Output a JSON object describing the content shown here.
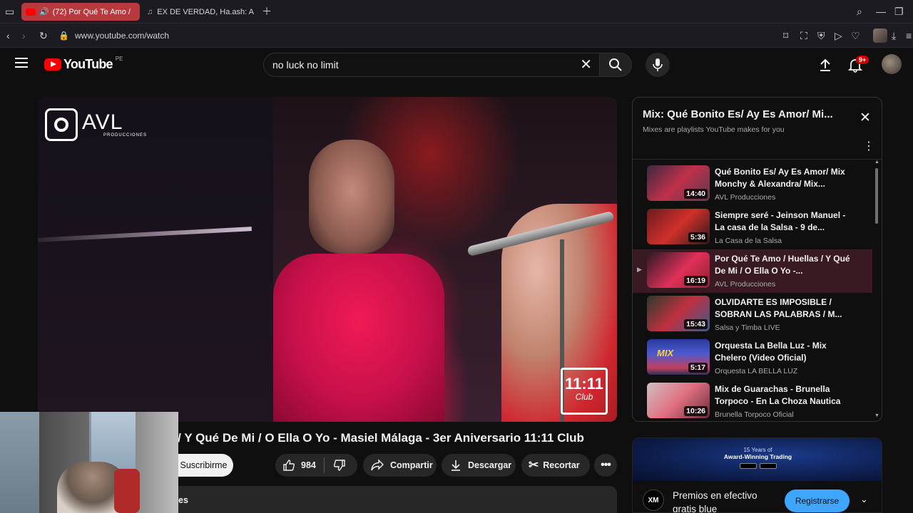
{
  "browser": {
    "tabs": [
      {
        "label": "(72) Por Qué Te Amo /",
        "active": true
      },
      {
        "label": "EX DE VERDAD, Ha.ash: A",
        "active": false
      }
    ],
    "url": "www.youtube.com/watch"
  },
  "header": {
    "logo_text": "YouTube",
    "country": "PE",
    "search_value": "no luck no limit",
    "notification_badge": "9+"
  },
  "player": {
    "watermark": "AVL",
    "watermark_sub": "PRODUCCIONES",
    "corner_logo_top": "11:11",
    "corner_logo_bottom": "Club"
  },
  "video": {
    "title": "s / Y Qué De Mi / O Ella O Yo - Masiel Málaga - 3er Aniversario 11:11 Club",
    "subscribe_label": "Suscribirme",
    "likes": "984",
    "share_label": "Compartir",
    "download_label": "Descargar",
    "clip_label": "Recortar",
    "desc_snippet": "es"
  },
  "mix": {
    "title": "Mix: Qué Bonito Es/ Ay Es Amor/ Mi...",
    "subtitle": "Mixes are playlists YouTube makes for you",
    "items": [
      {
        "title": "Qué Bonito Es/ Ay Es Amor/ Mix Monchy & Alexandra/ Mix...",
        "channel": "AVL Producciones",
        "duration": "14:40",
        "active": false
      },
      {
        "title": "Siempre seré - Jeinson Manuel - La casa de la Salsa - 9 de...",
        "channel": "La Casa de la Salsa",
        "duration": "5:36",
        "active": false
      },
      {
        "title": "Por Qué Te Amo / Huellas / Y Qué De Mi / O Ella O Yo -...",
        "channel": "AVL Producciones",
        "duration": "16:19",
        "active": true
      },
      {
        "title": "OLVIDARTE ES IMPOSIBLE / SOBRAN LAS PALABRAS / M...",
        "channel": "Salsa y Timba LIVE",
        "duration": "15:43",
        "active": false
      },
      {
        "title": "Orquesta La Bella Luz - Mix Chelero (Video Oficial)",
        "channel": "Orquesta LA BELLA LUZ",
        "duration": "5:17",
        "active": false
      },
      {
        "title": "Mix de Guarachas - Brunella Torpoco - En La Choza Nautica",
        "channel": "Brunella Torpoco Oficial",
        "duration": "10:26",
        "active": false
      }
    ]
  },
  "ad": {
    "banner_line1": "15 Years of",
    "banner_line2": "Award-Winning Trading",
    "brand": "XM",
    "text": "Premios en efectivo",
    "text2": "gratis blue",
    "cta": "Registrarse"
  },
  "colors": {
    "bg": "#0f0f0f",
    "accent_red": "#ff0000",
    "cta_blue": "#3ea6ff",
    "active_tab": "#b83a3f"
  }
}
